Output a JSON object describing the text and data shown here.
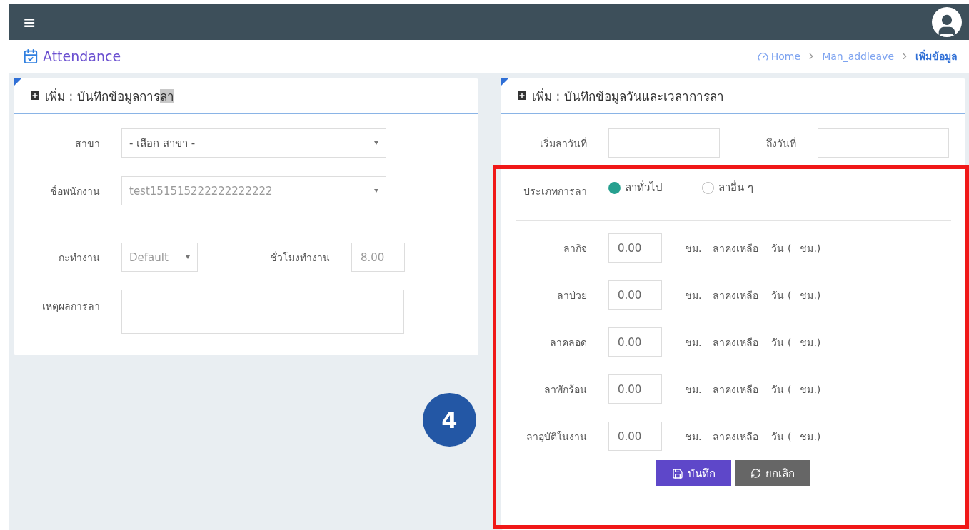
{
  "topbar": {
    "menu_icon": "≡"
  },
  "header": {
    "title": "Attendance",
    "breadcrumb": [
      {
        "label": "Home",
        "kind": "home",
        "selected": false
      },
      {
        "label": "Man_addleave",
        "kind": "link",
        "selected": false
      },
      {
        "label": "เพิ่มข้อมูล",
        "kind": "link",
        "selected": true
      }
    ]
  },
  "left_panel": {
    "title": "เพิ่ม : บันทึกข้อมูลการ",
    "title_highlight": "ลา",
    "branch": {
      "label": "สาขา",
      "value": "- เลือก สาขา -"
    },
    "employee": {
      "label": "ชื่อพนักงาน",
      "value": "test151515222222222222"
    },
    "shift": {
      "label": "กะทำงาน",
      "value": "Default"
    },
    "work_hours": {
      "label": "ชั่วโมงทำงาน",
      "value": "8.00"
    },
    "reason": {
      "label": "เหตุผลการลา"
    }
  },
  "right_panel": {
    "title": "เพิ่ม : บันทึกข้อมูลวันและเวลาการลา",
    "start_date": {
      "label": "เริ่มลาวันที่"
    },
    "end_date": {
      "label": "ถึงวันที่"
    },
    "leave_type": {
      "label": "ประเภทการลา",
      "options": [
        {
          "label": "ลาทั่วไป",
          "selected": true
        },
        {
          "label": "ลาอื่น ๆ",
          "selected": false
        }
      ]
    },
    "leave_rows": [
      {
        "label": "ลากิจ",
        "value": "0.00",
        "unit": "ชม.",
        "remaining": "ลาคงเหลือ",
        "days": "วัน (",
        "hours": "ชม.)"
      },
      {
        "label": "ลาป่วย",
        "value": "0.00",
        "unit": "ชม.",
        "remaining": "ลาคงเหลือ",
        "days": "วัน (",
        "hours": "ชม.)"
      },
      {
        "label": "ลาคลอด",
        "value": "0.00",
        "unit": "ชม.",
        "remaining": "ลาคงเหลือ",
        "days": "วัน (",
        "hours": "ชม.)"
      },
      {
        "label": "ลาพักร้อน",
        "value": "0.00",
        "unit": "ชม.",
        "remaining": "ลาคงเหลือ",
        "days": "วัน (",
        "hours": "ชม.)"
      },
      {
        "label": "ลาอุบัติในงาน",
        "value": "0.00",
        "unit": "ชม.",
        "remaining": "ลาคงเหลือ",
        "days": "วัน (",
        "hours": "ชม.)"
      }
    ],
    "buttons": [
      {
        "label": "บันทึก",
        "kind": "save"
      },
      {
        "label": "ยกเลิก",
        "kind": "cancel"
      }
    ]
  },
  "annotation": {
    "marker": "4"
  }
}
